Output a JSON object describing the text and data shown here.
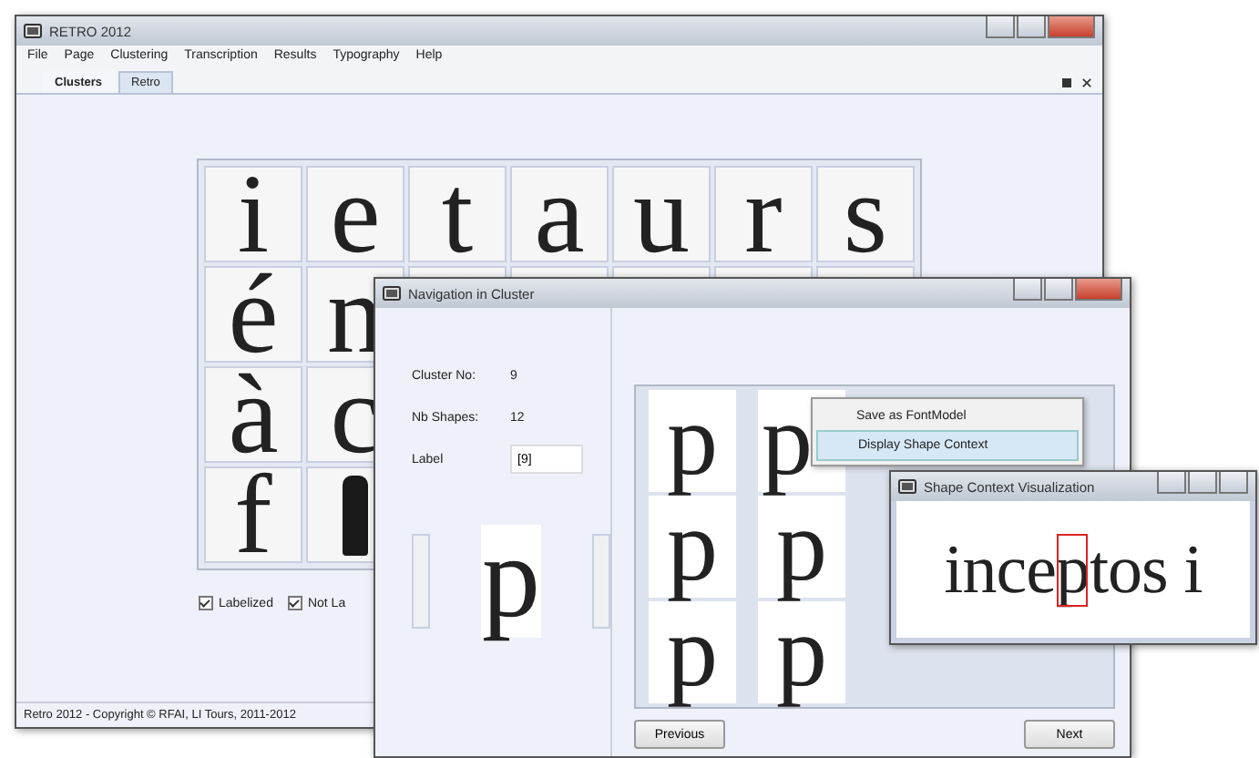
{
  "main_window": {
    "title": "RETRO 2012",
    "menu": [
      "File",
      "Page",
      "Clustering",
      "Transcription",
      "Results",
      "Typography",
      "Help"
    ],
    "tabs": [
      {
        "label": "Clusters",
        "selected": true
      },
      {
        "label": "Retro",
        "selected": false
      }
    ],
    "cluster_grid": [
      [
        {
          "kind": "glyph",
          "text": "i"
        },
        {
          "kind": "glyph",
          "text": "e"
        },
        {
          "kind": "glyph",
          "text": "t"
        },
        {
          "kind": "glyph",
          "text": "a"
        },
        {
          "kind": "glyph",
          "text": "u"
        },
        {
          "kind": "glyph",
          "text": "r"
        },
        {
          "kind": "glyph",
          "text": "s"
        }
      ],
      [
        {
          "kind": "glyph",
          "text": "é"
        },
        {
          "kind": "glyph",
          "text": "n"
        }
      ],
      [
        {
          "kind": "glyph",
          "text": "à"
        },
        {
          "kind": "glyph",
          "text": "c"
        }
      ],
      [
        {
          "kind": "glyph",
          "text": "f"
        },
        {
          "kind": "blot"
        }
      ]
    ],
    "filters": [
      {
        "label": "Labelized",
        "checked": true
      },
      {
        "label": "Not La",
        "checked": true
      }
    ],
    "status_bar": "Retro 2012 - Copyright © RFAI, LI Tours, 2011-2012"
  },
  "nav_window": {
    "title": "Navigation in Cluster",
    "info": [
      {
        "label": "Cluster No:",
        "value": "9"
      },
      {
        "label": "Nb Shapes:",
        "value": "12"
      }
    ],
    "label_field": {
      "label": "Label",
      "value": "[9]"
    },
    "preview_glyph": "p",
    "shapes": [
      [
        "p",
        "p"
      ],
      [
        "p",
        "p"
      ],
      [
        "p",
        "p"
      ]
    ],
    "buttons": [
      "Previous",
      "Next"
    ]
  },
  "context_menu": [
    {
      "label": "Save as FontModel",
      "selected": false
    },
    {
      "label": "Display Shape Context",
      "selected": true
    }
  ],
  "shape_context_window": {
    "title": "Shape Context Visualization",
    "text_before": "ince",
    "highlighted": "p",
    "text_after": "tos i"
  }
}
